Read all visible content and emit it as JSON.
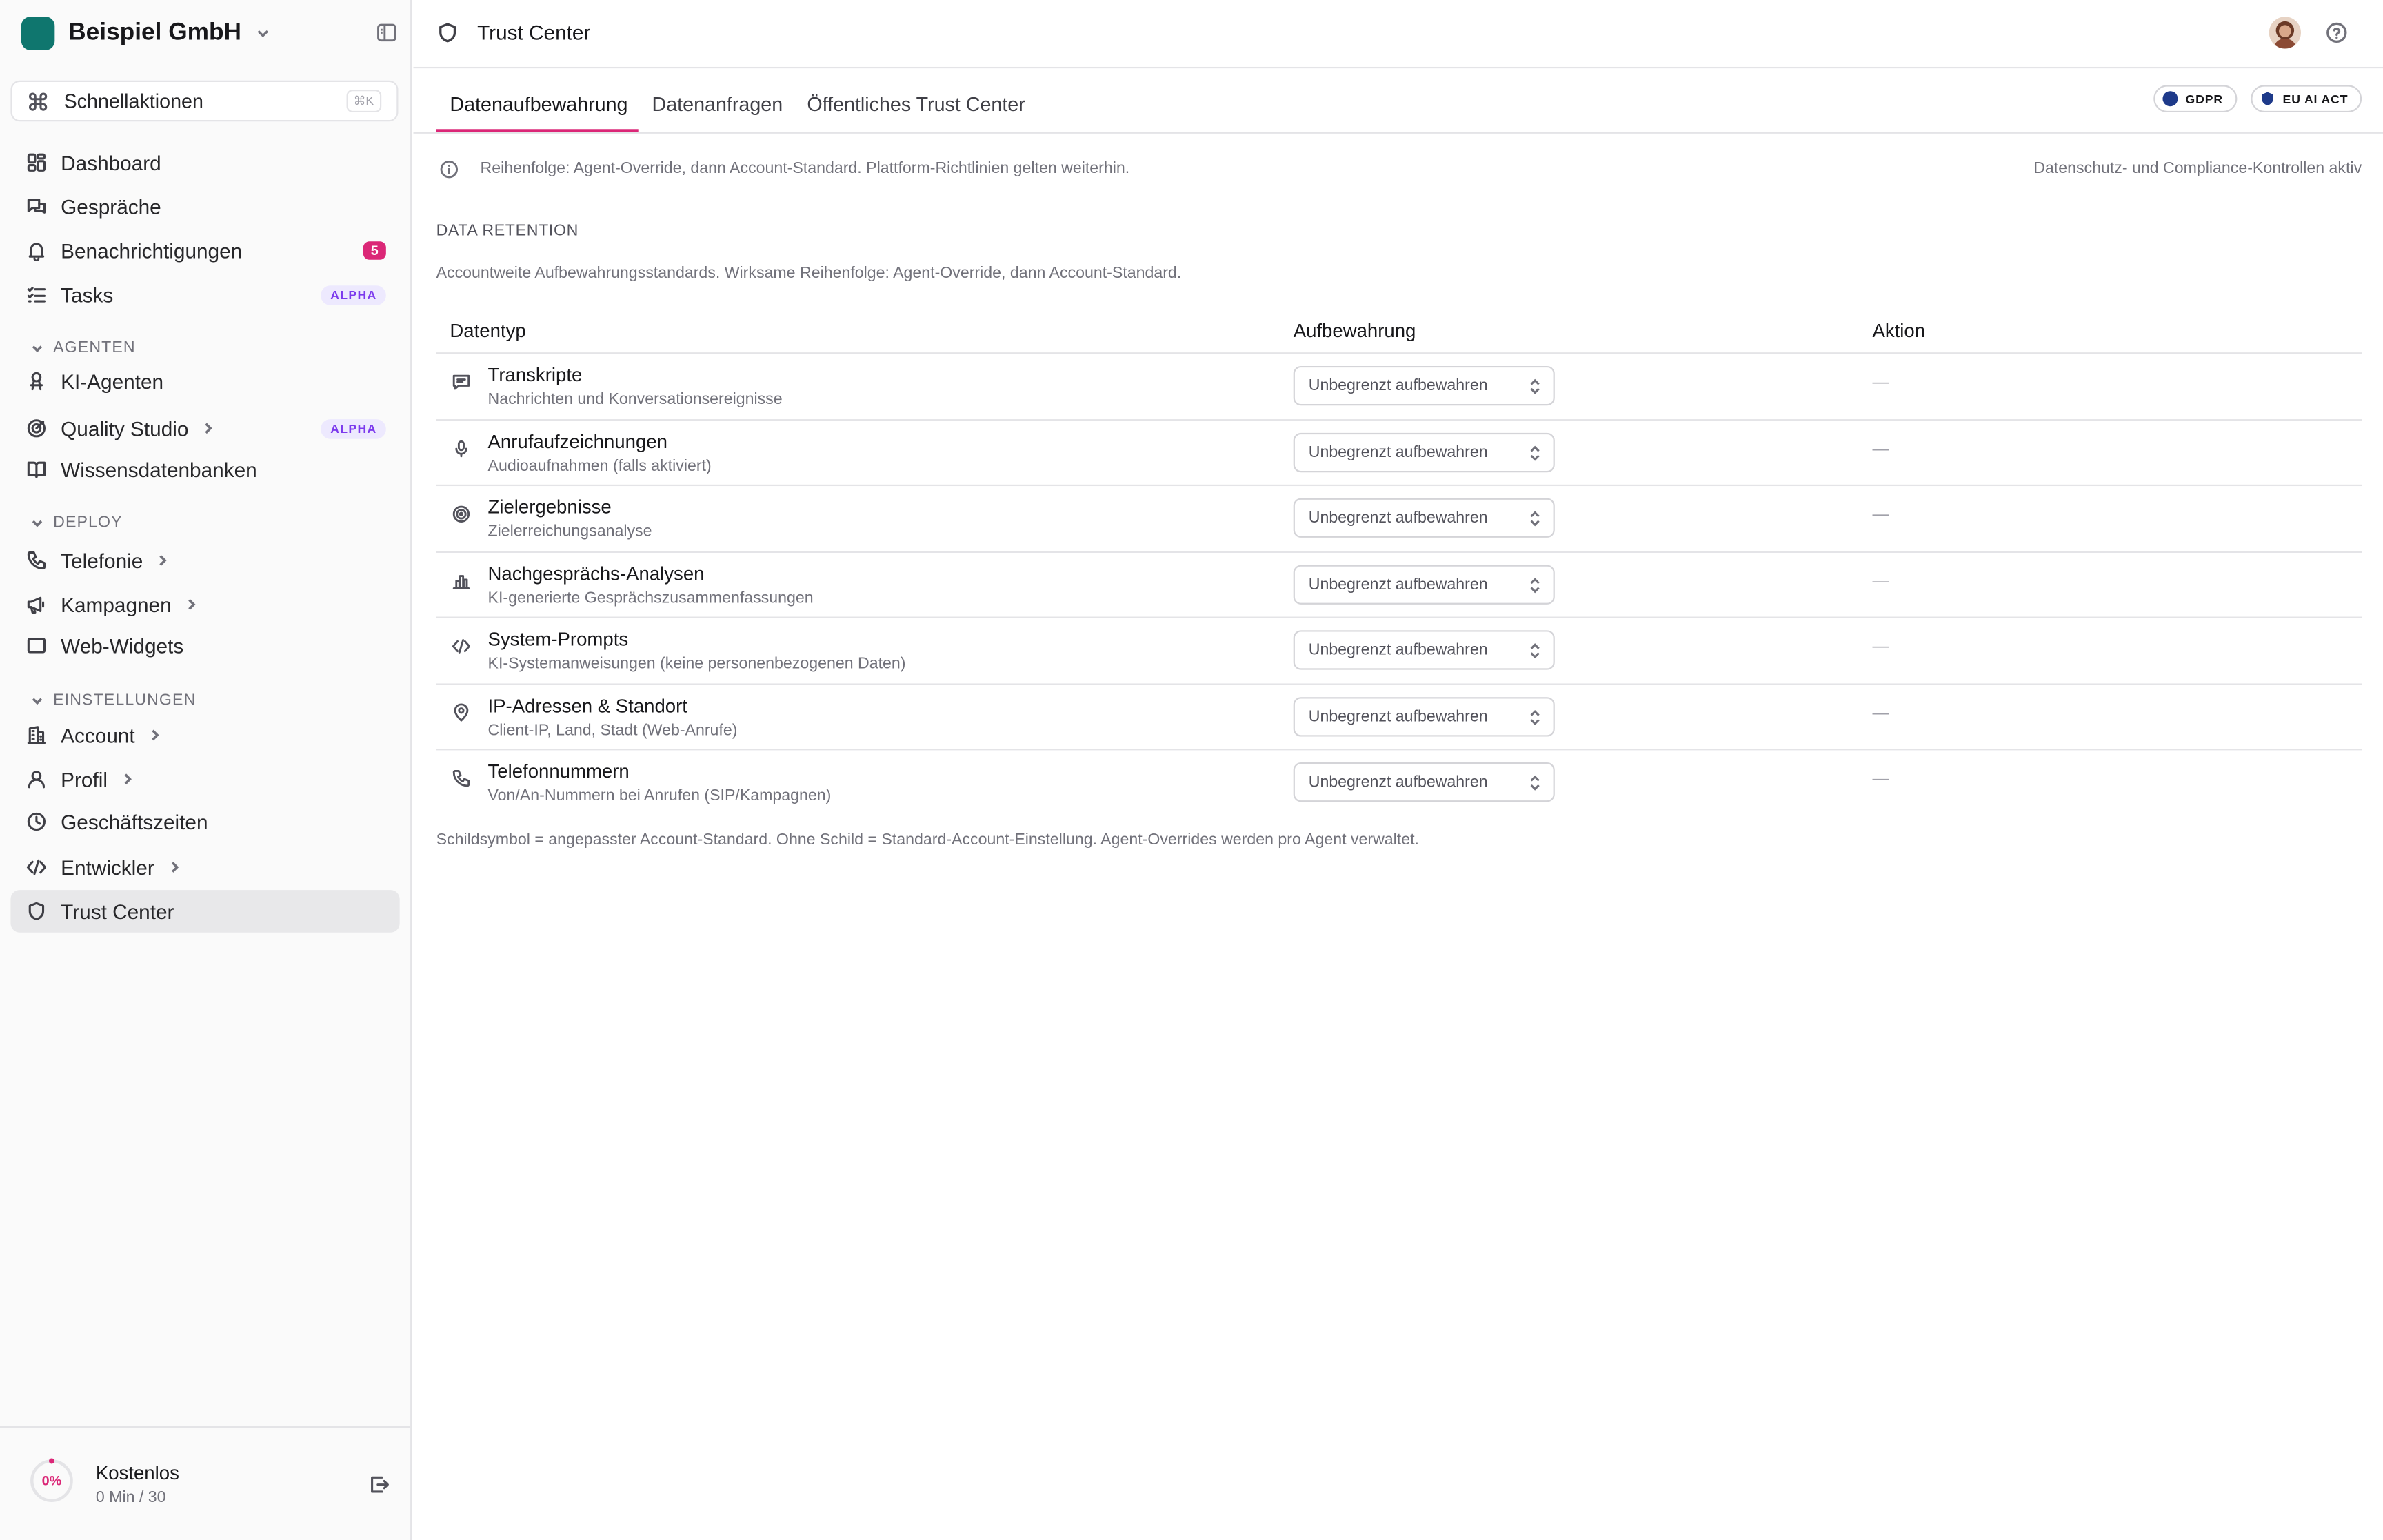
{
  "org": {
    "name": "Beispiel GmbH"
  },
  "quick_actions": {
    "label": "Schnellaktionen",
    "shortcut": "⌘K"
  },
  "nav": {
    "dashboard": "Dashboard",
    "conversations": "Gespräche",
    "notifications": "Benachrichtigungen",
    "notifications_count": "5",
    "tasks": "Tasks",
    "alpha_badge": "ALPHA",
    "section_agents": "AGENTEN",
    "ai_agents": "KI-Agenten",
    "quality_studio": "Quality Studio",
    "knowledge_bases": "Wissensdatenbanken",
    "section_deploy": "DEPLOY",
    "telephony": "Telefonie",
    "campaigns": "Kampagnen",
    "web_widgets": "Web-Widgets",
    "section_settings": "EINSTELLUNGEN",
    "account": "Account",
    "profile": "Profil",
    "business_hours": "Geschäftszeiten",
    "developer": "Entwickler",
    "trust_center": "Trust Center"
  },
  "plan": {
    "percent": "0%",
    "progress_fraction": 0,
    "name": "Kostenlos",
    "usage": "0 Min / 30"
  },
  "header": {
    "title": "Trust Center"
  },
  "tabs": [
    {
      "label": "Datenaufbewahrung",
      "active": true
    },
    {
      "label": "Datenanfragen",
      "active": false
    },
    {
      "label": "Öffentliches Trust Center",
      "active": false
    }
  ],
  "badges": {
    "gdpr": "GDPR",
    "eu_ai_act": "EU AI ACT"
  },
  "info": {
    "text": "Reihenfolge: Agent-Override, dann Account-Standard. Plattform-Richtlinien gelten weiterhin.",
    "status": "Datenschutz- und Compliance-Kontrollen aktiv"
  },
  "retention": {
    "title": "DATA RETENTION",
    "description": "Accountweite Aufbewahrungsstandards. Wirksame Reihenfolge: Agent-Override, dann Account-Standard.",
    "columns": {
      "type": "Datentyp",
      "retention": "Aufbewahrung",
      "action": "Aktion"
    },
    "rows": [
      {
        "icon": "message-icon",
        "title": "Transkripte",
        "subtitle": "Nachrichten und Konversationsereignisse",
        "value": "Unbegrenzt aufbewahren",
        "action": "—"
      },
      {
        "icon": "microphone-icon",
        "title": "Anrufaufzeichnungen",
        "subtitle": "Audioaufnahmen (falls aktiviert)",
        "value": "Unbegrenzt aufbewahren",
        "action": "—"
      },
      {
        "icon": "target-icon",
        "title": "Zielergebnisse",
        "subtitle": "Zielerreichungsanalyse",
        "value": "Unbegrenzt aufbewahren",
        "action": "—"
      },
      {
        "icon": "bar-chart-icon",
        "title": "Nachgesprächs-Analysen",
        "subtitle": "KI-generierte Gesprächszusammenfassungen",
        "value": "Unbegrenzt aufbewahren",
        "action": "—"
      },
      {
        "icon": "code-icon",
        "title": "System-Prompts",
        "subtitle": "KI-Systemanweisungen (keine personenbezogenen Daten)",
        "value": "Unbegrenzt aufbewahren",
        "action": "—"
      },
      {
        "icon": "map-pin-icon",
        "title": "IP-Adressen & Standort",
        "subtitle": "Client-IP, Land, Stadt (Web-Anrufe)",
        "value": "Unbegrenzt aufbewahren",
        "action": "—"
      },
      {
        "icon": "phone-icon",
        "title": "Telefonnummern",
        "subtitle": "Von/An-Nummern bei Anrufen (SIP/Kampagnen)",
        "value": "Unbegrenzt aufbewahren",
        "action": "—"
      }
    ],
    "footnote": "Schildsymbol = angepasster Account-Standard. Ohne Schild = Standard-Account-Einstellung. Agent-Overrides werden pro Agent verwaltet."
  },
  "colors": {
    "accent": "#db2777",
    "brand": "#0f766e",
    "alpha": "#7c3aed",
    "compliance": "#1e3a8a"
  }
}
